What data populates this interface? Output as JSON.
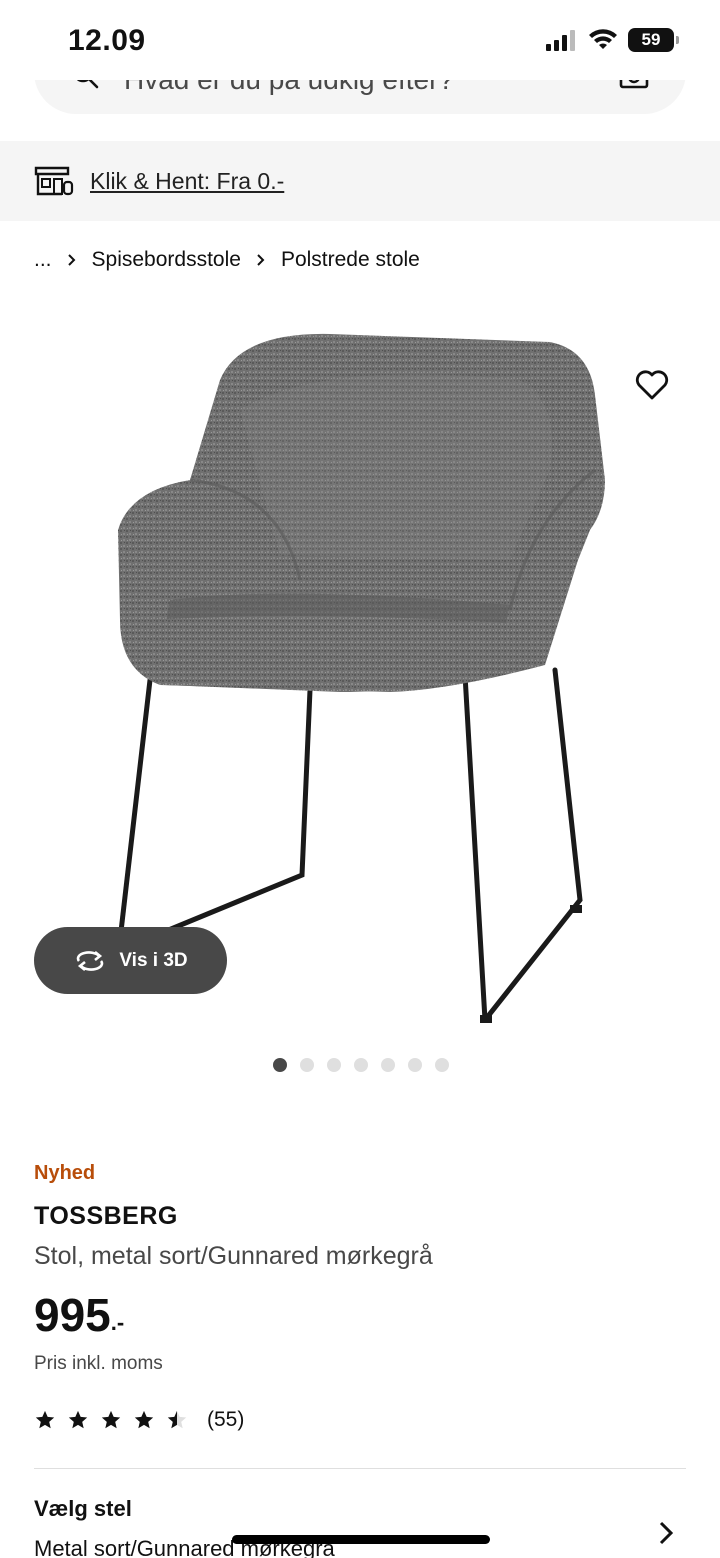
{
  "status_bar": {
    "time": "12.09",
    "battery": "59"
  },
  "search": {
    "placeholder": "Hvad er du på udkig efter?"
  },
  "banner": {
    "text": "Klik & Hent: Fra 0.-"
  },
  "breadcrumb": {
    "items": [
      "...",
      "Spisebordsstole",
      "Polstrede stole"
    ]
  },
  "gallery": {
    "view_3d_label": "Vis i 3D",
    "total_images": 7,
    "active_index": 0
  },
  "product": {
    "badge": "Nyhed",
    "name": "TOSSBERG",
    "description": "Stol, metal sort/Gunnared mørkegrå",
    "price": "995",
    "price_suffix": ".-",
    "price_note": "Pris inkl. moms",
    "rating_stars": 4.5,
    "rating_count": "(55)"
  },
  "frame_selector": {
    "title": "Vælg stel",
    "value": "Metal sort/Gunnared mørkegrå"
  },
  "colors": {
    "badge_orange": "#b84d0a",
    "button_dark": "#484848",
    "banner_bg": "#f5f5f5"
  }
}
